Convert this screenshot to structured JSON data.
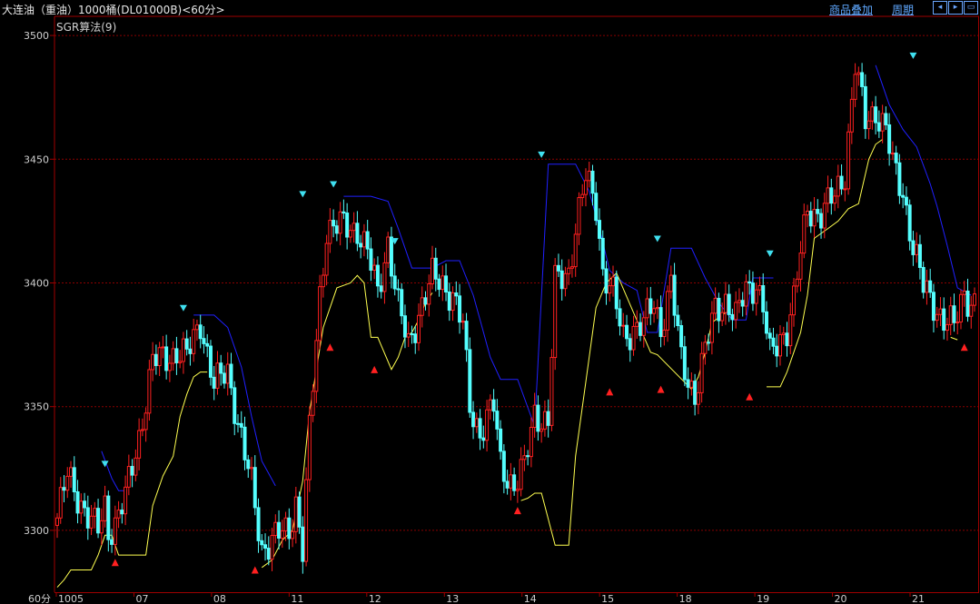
{
  "header": {
    "title": "大连油（重油）1000桶(DL01000B)<60分>",
    "overlay_label": "商品叠加",
    "period_label": "周期",
    "nav_icons": [
      "arrow-left-icon",
      "arrow-right-icon",
      "fullscreen-icon"
    ]
  },
  "indicator_label": "SGR算法(9)",
  "colors": {
    "background": "#000000",
    "up": "#ff2020",
    "down": "#54ffff",
    "upper_line": "#2020ff",
    "lower_line": "#ffff50",
    "grid": "#8a0000",
    "axis": "#a00000",
    "sell_marker": "#40e0f0",
    "buy_marker": "#ff2020"
  },
  "chart_data": {
    "type": "candlestick",
    "period_label": "60分",
    "x_labels": [
      "1005",
      "07",
      "08",
      "11",
      "12",
      "13",
      "14",
      "15",
      "18",
      "19",
      "20",
      "21"
    ],
    "y_ticks": [
      3300,
      3350,
      3400,
      3450,
      3500
    ],
    "ylim": [
      3275,
      3507
    ],
    "grid": true,
    "waypoints": [
      [
        0,
        3305
      ],
      [
        3,
        3322
      ],
      [
        5,
        3317
      ],
      [
        10,
        3303
      ],
      [
        12,
        3300
      ],
      [
        14,
        3310
      ],
      [
        15,
        3300
      ],
      [
        17,
        3303
      ],
      [
        20,
        3313
      ],
      [
        24,
        3338
      ],
      [
        28,
        3368
      ],
      [
        35,
        3372
      ],
      [
        38,
        3370
      ],
      [
        42,
        3385
      ],
      [
        46,
        3358
      ],
      [
        50,
        3365
      ],
      [
        55,
        3330
      ],
      [
        57,
        3318
      ],
      [
        60,
        3293
      ],
      [
        65,
        3298
      ],
      [
        68,
        3300
      ],
      [
        70,
        3312
      ],
      [
        72,
        3292
      ],
      [
        74,
        3340
      ],
      [
        77,
        3395
      ],
      [
        79,
        3422
      ],
      [
        84,
        3423
      ],
      [
        88,
        3422
      ],
      [
        91,
        3412
      ],
      [
        94,
        3396
      ],
      [
        97,
        3417
      ],
      [
        100,
        3390
      ],
      [
        103,
        3375
      ],
      [
        106,
        3388
      ],
      [
        110,
        3402
      ],
      [
        113,
        3400
      ],
      [
        116,
        3395
      ],
      [
        119,
        3382
      ],
      [
        121,
        3350
      ],
      [
        124,
        3340
      ],
      [
        128,
        3350
      ],
      [
        130,
        3327
      ],
      [
        134,
        3318
      ],
      [
        137,
        3325
      ],
      [
        140,
        3348
      ],
      [
        144,
        3343
      ],
      [
        146,
        3400
      ],
      [
        150,
        3405
      ],
      [
        152,
        3422
      ],
      [
        155,
        3442
      ],
      [
        158,
        3432
      ],
      [
        160,
        3405
      ],
      [
        163,
        3395
      ],
      [
        166,
        3378
      ],
      [
        169,
        3382
      ],
      [
        172,
        3383
      ],
      [
        175,
        3392
      ],
      [
        177,
        3382
      ],
      [
        180,
        3400
      ],
      [
        183,
        3368
      ],
      [
        187,
        3355
      ],
      [
        190,
        3372
      ],
      [
        193,
        3390
      ],
      [
        196,
        3393
      ],
      [
        199,
        3385
      ],
      [
        202,
        3398
      ],
      [
        205,
        3400
      ],
      [
        207,
        3390
      ],
      [
        209,
        3370
      ],
      [
        212,
        3378
      ],
      [
        214,
        3382
      ],
      [
        216,
        3393
      ],
      [
        220,
        3430
      ],
      [
        224,
        3428
      ],
      [
        228,
        3435
      ],
      [
        231,
        3445
      ],
      [
        234,
        3488
      ],
      [
        237,
        3465
      ],
      [
        240,
        3470
      ],
      [
        243,
        3462
      ],
      [
        245,
        3447
      ],
      [
        248,
        3437
      ],
      [
        251,
        3415
      ],
      [
        254,
        3398
      ],
      [
        257,
        3392
      ],
      [
        260,
        3385
      ],
      [
        263,
        3382
      ],
      [
        266,
        3397
      ],
      [
        268,
        3392
      ]
    ],
    "sell_signals": [
      [
        14,
        3327
      ],
      [
        37,
        3390
      ],
      [
        72,
        3436
      ],
      [
        81,
        3440
      ],
      [
        99,
        3417
      ],
      [
        142,
        3452
      ],
      [
        176,
        3418
      ],
      [
        209,
        3412
      ],
      [
        251,
        3492
      ]
    ],
    "buy_signals": [
      [
        17,
        3287
      ],
      [
        58,
        3284
      ],
      [
        80,
        3374
      ],
      [
        93,
        3365
      ],
      [
        135,
        3308
      ],
      [
        162,
        3356
      ],
      [
        177,
        3357
      ],
      [
        203,
        3354
      ],
      [
        266,
        3374
      ]
    ],
    "upper_band": [
      [
        13,
        3332
      ],
      [
        16,
        3321
      ],
      [
        18,
        3316
      ],
      [
        20,
        3316
      ],
      [
        40,
        3387
      ],
      [
        46,
        3387
      ],
      [
        50,
        3382
      ],
      [
        54,
        3366
      ],
      [
        57,
        3346
      ],
      [
        60,
        3328
      ],
      [
        64,
        3318
      ],
      [
        84,
        3435
      ],
      [
        92,
        3435
      ],
      [
        97,
        3433
      ],
      [
        100,
        3422
      ],
      [
        104,
        3406
      ],
      [
        110,
        3406
      ],
      [
        114,
        3409
      ],
      [
        118,
        3409
      ],
      [
        122,
        3395
      ],
      [
        124,
        3385
      ],
      [
        127,
        3370
      ],
      [
        130,
        3361
      ],
      [
        135,
        3361
      ],
      [
        140,
        3342
      ],
      [
        144,
        3448
      ],
      [
        152,
        3448
      ],
      [
        156,
        3437
      ],
      [
        159,
        3422
      ],
      [
        162,
        3405
      ],
      [
        166,
        3400
      ],
      [
        170,
        3397
      ],
      [
        173,
        3380
      ],
      [
        176,
        3380
      ],
      [
        180,
        3414
      ],
      [
        186,
        3414
      ],
      [
        190,
        3402
      ],
      [
        194,
        3392
      ],
      [
        198,
        3385
      ],
      [
        202,
        3385
      ],
      [
        204,
        3402
      ],
      [
        210,
        3402
      ],
      [
        240,
        3488
      ],
      [
        244,
        3472
      ],
      [
        248,
        3462
      ],
      [
        252,
        3455
      ],
      [
        256,
        3440
      ],
      [
        258,
        3431
      ],
      [
        261,
        3415
      ],
      [
        264,
        3398
      ],
      [
        268,
        3395
      ]
    ],
    "lower_band": [
      [
        0,
        3277
      ],
      [
        2,
        3280
      ],
      [
        4,
        3284
      ],
      [
        10,
        3284
      ],
      [
        12,
        3290
      ],
      [
        14,
        3298
      ],
      [
        16,
        3298
      ],
      [
        18,
        3290
      ],
      [
        26,
        3290
      ],
      [
        28,
        3310
      ],
      [
        31,
        3322
      ],
      [
        34,
        3330
      ],
      [
        36,
        3346
      ],
      [
        38,
        3355
      ],
      [
        40,
        3362
      ],
      [
        42,
        3364
      ],
      [
        44,
        3364
      ],
      [
        60,
        3285
      ],
      [
        63,
        3288
      ],
      [
        66,
        3296
      ],
      [
        69,
        3300
      ],
      [
        72,
        3320
      ],
      [
        74,
        3348
      ],
      [
        78,
        3382
      ],
      [
        82,
        3398
      ],
      [
        86,
        3400
      ],
      [
        88,
        3403
      ],
      [
        90,
        3400
      ],
      [
        92,
        3378
      ],
      [
        94,
        3378
      ],
      [
        98,
        3365
      ],
      [
        100,
        3370
      ],
      [
        102,
        3378
      ],
      [
        104,
        3380
      ],
      [
        106,
        3385
      ],
      [
        108,
        3392
      ],
      [
        110,
        3396
      ],
      [
        136,
        3312
      ],
      [
        138,
        3313
      ],
      [
        140,
        3315
      ],
      [
        142,
        3315
      ],
      [
        146,
        3294
      ],
      [
        150,
        3294
      ],
      [
        152,
        3330
      ],
      [
        155,
        3360
      ],
      [
        158,
        3390
      ],
      [
        161,
        3400
      ],
      [
        164,
        3404
      ],
      [
        174,
        3372
      ],
      [
        176,
        3371
      ],
      [
        186,
        3357
      ],
      [
        188,
        3362
      ],
      [
        190,
        3372
      ],
      [
        192,
        3384
      ],
      [
        194,
        3386
      ],
      [
        196,
        3388
      ],
      [
        208,
        3358
      ],
      [
        212,
        3358
      ],
      [
        214,
        3364
      ],
      [
        216,
        3372
      ],
      [
        218,
        3380
      ],
      [
        220,
        3395
      ],
      [
        222,
        3418
      ],
      [
        224,
        3420
      ],
      [
        226,
        3422
      ],
      [
        229,
        3425
      ],
      [
        232,
        3430
      ],
      [
        235,
        3432
      ],
      [
        238,
        3450
      ],
      [
        240,
        3456
      ],
      [
        242,
        3458
      ],
      [
        262,
        3378
      ],
      [
        264,
        3377
      ]
    ]
  }
}
